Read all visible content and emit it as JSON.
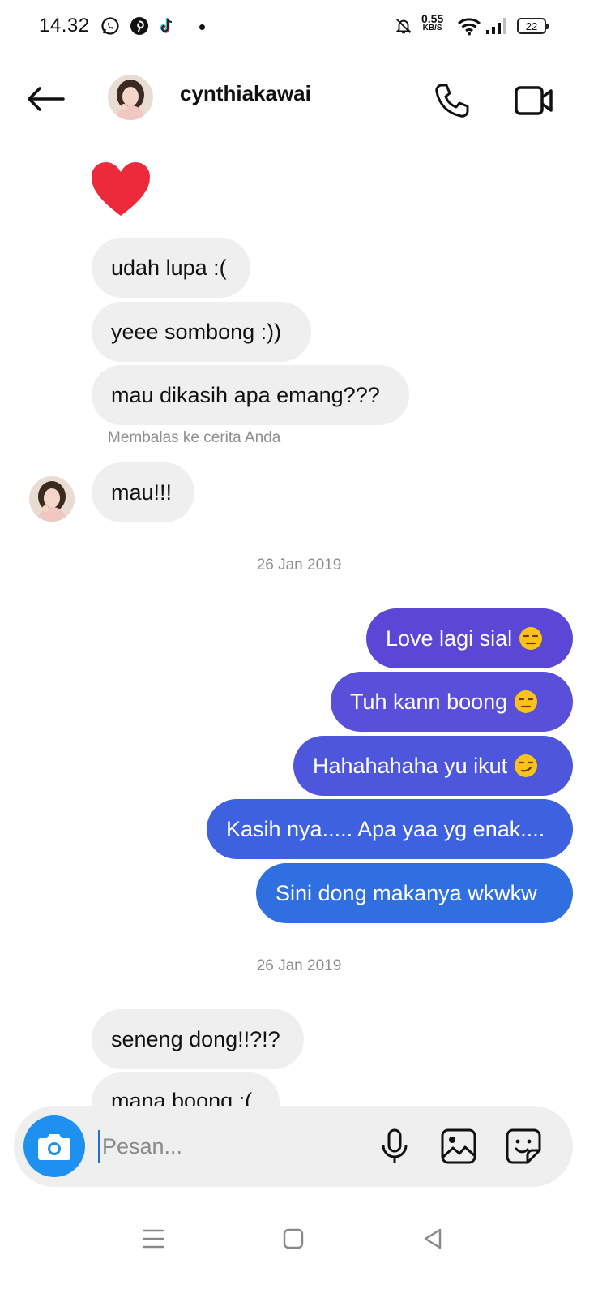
{
  "status_bar": {
    "time": "14.32",
    "net_speed": "0.55",
    "net_unit": "KB/S",
    "battery": "22"
  },
  "header": {
    "username": "cynthiakawai"
  },
  "messages": {
    "in_1": "udah lupa :(",
    "in_2": "yeee sombong :))",
    "in_3": "mau dikasih apa emang???",
    "reply_note": "Membalas ke cerita Anda",
    "in_4": "mau!!!",
    "date_1": "26 Jan 2019",
    "out_1": "Love lagi sial",
    "out_2": "Tuh kann boong",
    "out_3": "Hahahahaha yu ikut",
    "out_4": "Kasih nya..... Apa yaa yg enak....",
    "out_5": "Sini dong makanya wkwkw",
    "date_2": "26 Jan 2019",
    "in_5": "seneng dong!!?!?",
    "in_6": "mana boong :("
  },
  "composer": {
    "placeholder": "Pesan..."
  },
  "colors": {
    "accent": "#1e90f0",
    "out_bubble_top": "#5b47d6",
    "out_bubble_bottom": "#2f6fe0",
    "heart": "#ed2a3c"
  }
}
